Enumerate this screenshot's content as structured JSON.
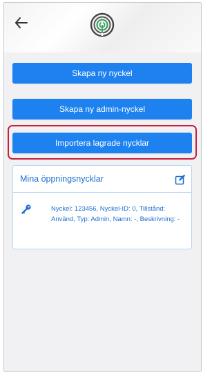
{
  "header": {
    "back_icon": "arrow-left-icon",
    "logo_icon": "fingerprint-logo-icon"
  },
  "buttons": {
    "create_key": "Skapa ny nyckel",
    "create_admin_key": "Skapa ny admin-nyckel",
    "import_saved_keys": "Importera lagrade nycklar"
  },
  "keys_card": {
    "title": "Mina öppningsnycklar",
    "edit_icon": "edit-icon",
    "item": {
      "icon": "key-icon",
      "description": "Nyckel: 123456, Nyckel-ID: 0, Tillstånd: Använd, Typ: Admin, Namn: -, Beskrivning: -"
    }
  },
  "colors": {
    "accent": "#1d82f0",
    "highlight": "#c81f3a",
    "card_text": "#1d6fd0"
  }
}
